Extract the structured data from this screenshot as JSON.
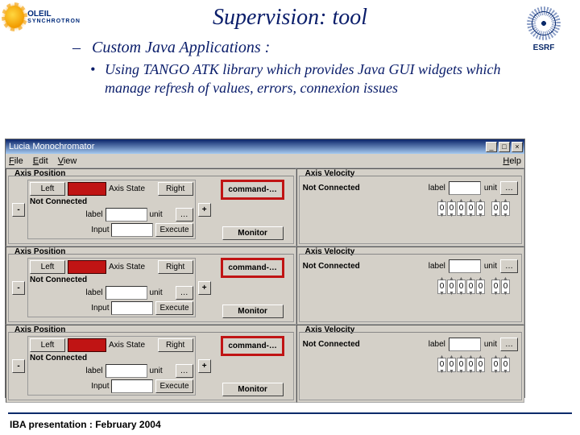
{
  "logos": {
    "left_text": "OLEIL",
    "left_sub": "SYNCHROTRON",
    "right_text": "ESRF"
  },
  "slide": {
    "title": "Supervision: tool",
    "bullet1": "Custom Java Applications :",
    "bullet2": "Using TANGO ATK library which provides Java GUI widgets which manage refresh of values, errors, connexion issues"
  },
  "app": {
    "window_title": "Lucia Monochromator",
    "win_min": "_",
    "win_max": "□",
    "win_close": "×",
    "menu": {
      "file": "File",
      "edit": "Edit",
      "view": "View",
      "help": "Help"
    },
    "axis_position": {
      "title": "Axis Position",
      "minus": "-",
      "plus": "+",
      "left": "Left",
      "axis_state": "Axis State",
      "right": "Right",
      "not_connected": "Not Connected",
      "label": "label",
      "label_value": "",
      "unit": "unit",
      "dots": "…",
      "input": "Input",
      "input_value": "",
      "execute": "Execute",
      "command": "command-…",
      "monitor": "Monitor"
    },
    "axis_velocity": {
      "title": "Axis Velocity",
      "not_connected": "Not Connected",
      "label": "label",
      "label_value": "",
      "unit": "unit",
      "dots": "…",
      "digits_whole": [
        "0",
        "0",
        "0",
        "0",
        "0"
      ],
      "digits_frac": [
        "0",
        "0"
      ]
    }
  },
  "footer": "IBA presentation : February 2004"
}
